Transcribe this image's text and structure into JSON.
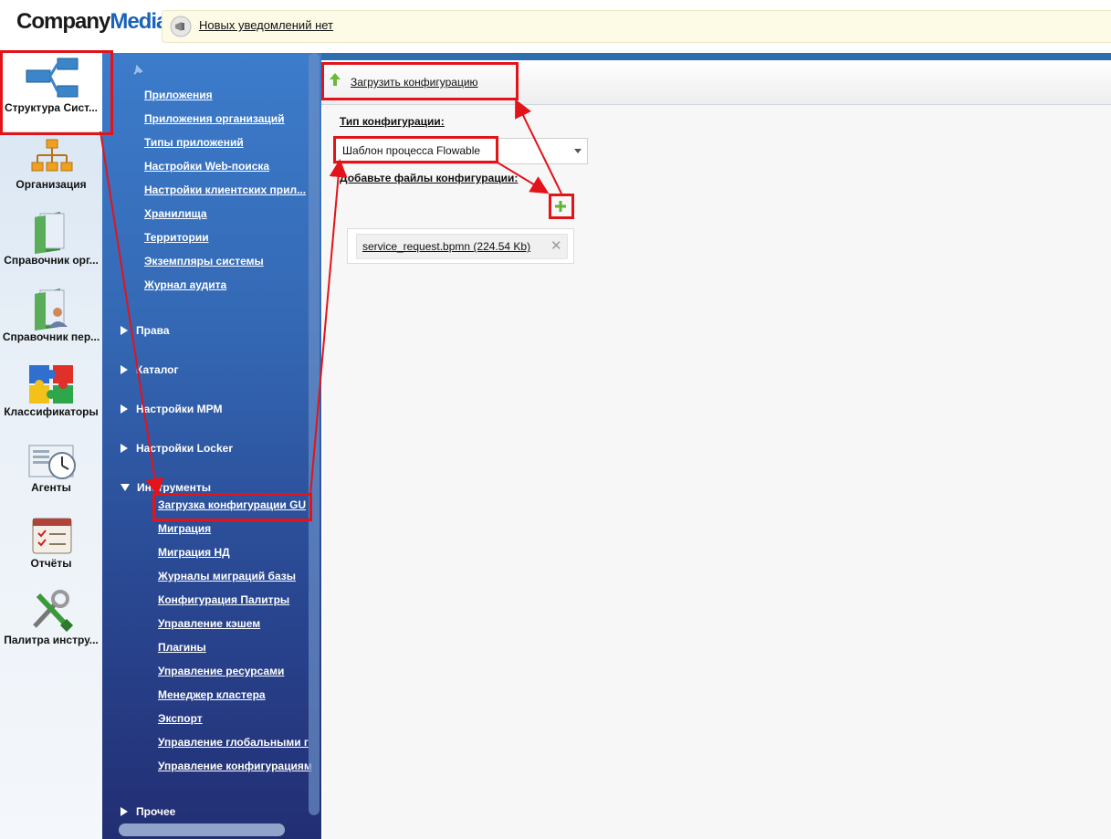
{
  "header": {
    "logo_part1": "Company",
    "logo_part2": "Media",
    "notification": "Новых уведомлений нет"
  },
  "rail": [
    {
      "label": "Структура Сист...",
      "icon": "structure-icon"
    },
    {
      "label": "Организация",
      "icon": "organization-icon"
    },
    {
      "label": "Справочник орг...",
      "icon": "org-directory-icon"
    },
    {
      "label": "Справочник пер...",
      "icon": "personnel-directory-icon"
    },
    {
      "label": "Классификаторы",
      "icon": "puzzle-icon"
    },
    {
      "label": "Агенты",
      "icon": "agents-clock-icon"
    },
    {
      "label": "Отчёты",
      "icon": "reports-icon"
    },
    {
      "label": "Палитра инстру...",
      "icon": "tools-icon"
    }
  ],
  "nav": {
    "links": [
      "Приложения",
      "Приложения организаций",
      "Типы приложений",
      "Настройки Web-поиска",
      "Настройки клиентских прил...",
      "Хранилища",
      "Территории",
      "Экземпляры системы",
      "Журнал аудита"
    ],
    "sections": [
      "Права",
      "Каталог",
      "Настройки МРМ",
      "Настройки Locker"
    ],
    "tools_section": "Инструменты",
    "tools_links": [
      "Загрузка конфигурации GU",
      "Миграция",
      "Миграция НД",
      "Журналы миграций базы",
      "Конфигурация Палитры",
      "Управление кэшем",
      "Плагины",
      "Управление ресурсами",
      "Менеджер кластера",
      "Экспорт",
      "Управление глобальными г",
      "Управление конфигурациям"
    ],
    "other_section": "Прочее"
  },
  "main": {
    "upload_button": "Загрузить конфигурацию",
    "config_type_label": "Тип конфигурации:",
    "config_type_value": "Шаблон процесса Flowable",
    "add_files_label": "Добавьте файлы конфигурации:",
    "file_name": "service_request.bpmn (224.54 Kb)",
    "remove_symbol": "✕",
    "add_symbol": "+"
  },
  "colors": {
    "annotation": "#e2141a",
    "nav_top": "#3c7ccb",
    "nav_bottom": "#222e73",
    "add_green": "#5fb336"
  }
}
